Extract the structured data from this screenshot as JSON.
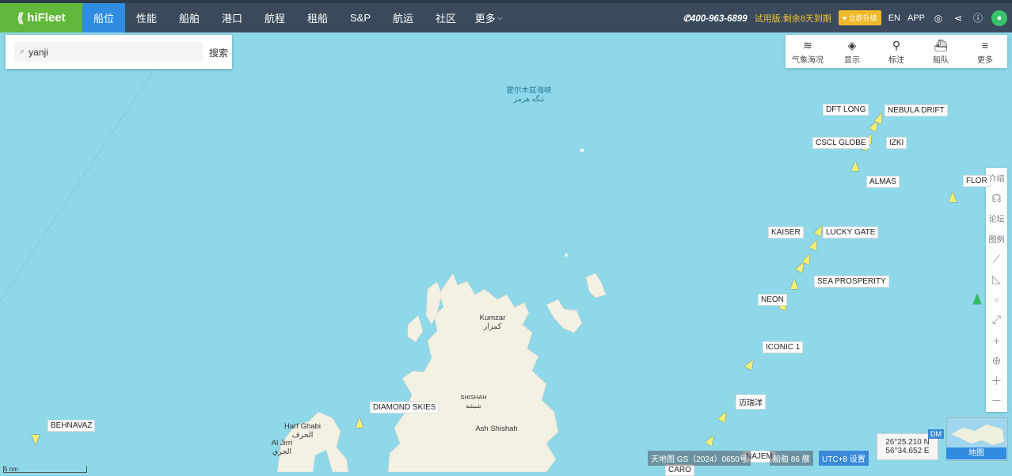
{
  "brand": {
    "name": "hiFleet"
  },
  "nav": [
    {
      "label": "船位",
      "active": true
    },
    {
      "label": "性能"
    },
    {
      "label": "船舶"
    },
    {
      "label": "港口"
    },
    {
      "label": "航程"
    },
    {
      "label": "租船"
    },
    {
      "label": "S&P"
    },
    {
      "label": "航运"
    },
    {
      "label": "社区"
    },
    {
      "label": "更多"
    }
  ],
  "header": {
    "phone": "400-963-6899",
    "trial_text": "试用版:剩余8天到期",
    "upgrade_label": "立即升级",
    "lang": "EN",
    "app": "APP"
  },
  "search": {
    "value": "yanji",
    "button_label": "搜索"
  },
  "map_tools": [
    {
      "label": "气象海况",
      "icon": "wind-icon"
    },
    {
      "label": "显示",
      "icon": "layers-icon"
    },
    {
      "label": "标注",
      "icon": "pin-icon"
    },
    {
      "label": "船队",
      "icon": "fleet-icon"
    },
    {
      "label": "更多",
      "icon": "menu-icon"
    }
  ],
  "side_tools": [
    {
      "label": "介绍"
    },
    {
      "label": "",
      "icon": "headset-icon"
    },
    {
      "label": "论坛"
    },
    {
      "label": "图例"
    },
    {
      "label": "",
      "icon": "ruler-icon"
    },
    {
      "label": "",
      "icon": "angle-icon"
    },
    {
      "label": "",
      "icon": "blank-icon"
    },
    {
      "label": "",
      "icon": "fullscreen-icon"
    },
    {
      "label": "",
      "icon": "crosshair-icon"
    },
    {
      "label": "",
      "icon": "locate-icon"
    },
    {
      "label": "",
      "icon": "zoom-in-icon"
    },
    {
      "label": "",
      "icon": "zoom-out-icon"
    }
  ],
  "places": {
    "strait_zh": "霍尔木兹海峡",
    "strait_fa": "تنگه هرمز",
    "kumzar_en": "Kumzar",
    "kumzar_ar": "كمزار",
    "shishah_en": "SHISHAH",
    "shishah_ar": "شيشة",
    "ash_shishah": "Ash Shishah",
    "harf_en": "Harf Ghabi",
    "harf_ar": "الحرف",
    "jirri_en": "Al Jirri",
    "jirri_ar": "الجري"
  },
  "ships": [
    {
      "name": "DFT LONG"
    },
    {
      "name": "NEBULA DRIFT"
    },
    {
      "name": "CSCL GLOBE"
    },
    {
      "name": "IZKI"
    },
    {
      "name": "ALMAS"
    },
    {
      "name": "FLOR"
    },
    {
      "name": "KAISER"
    },
    {
      "name": "LUCKY GATE"
    },
    {
      "name": "SEA PROSPERITY"
    },
    {
      "name": "NEON"
    },
    {
      "name": "ICONIC 1"
    },
    {
      "name": "迈瑞洋"
    },
    {
      "name": "NAJEM"
    },
    {
      "name": "CARO"
    },
    {
      "name": "DIAMOND SKIES"
    },
    {
      "name": "BEHNAVAZ"
    }
  ],
  "status": {
    "map_source": "天地图 GS（2024）0650号",
    "ship_count": "船舶 86 艘",
    "timezone": "UTC+8 设置",
    "lat": "26°25.210 N",
    "lon": "56°34.652 E",
    "coord_mode": "DM",
    "minimap_label": "地图",
    "scale": "5 nm"
  },
  "colors": {
    "nav_bg": "#3a4a5c",
    "active": "#2f8ce0",
    "brand": "#62b83a",
    "sea": "#8ed8ea",
    "land": "#f3f0e4",
    "ship": "#f3ee72"
  }
}
